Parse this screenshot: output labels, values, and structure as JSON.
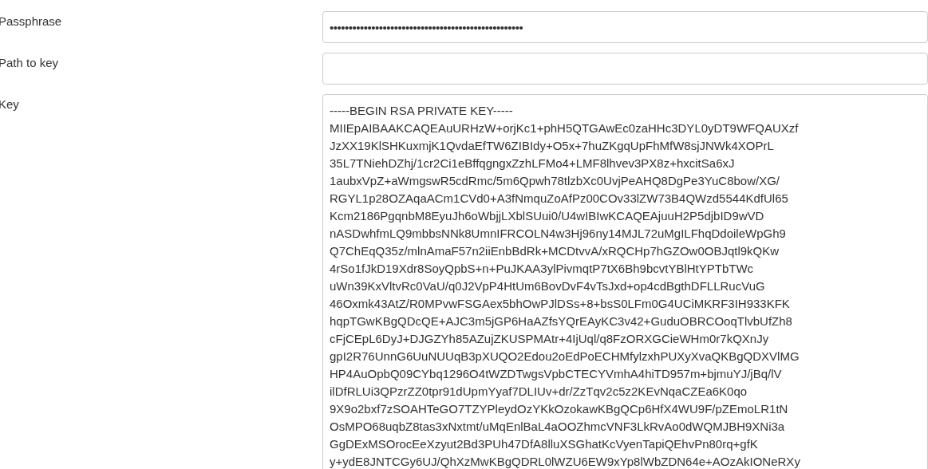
{
  "fields": [
    {
      "kind": "input",
      "label": "Passphrase",
      "value": "•••••••••••••••••••••••••••••••••••••••••••••••••••"
    },
    {
      "kind": "input",
      "label": "Path to key"
    },
    {
      "kind": "textarea",
      "label": "Key",
      "value": "-----BEGIN RSA PRIVATE KEY-----\nMIIEpAIBAAKCAQEAuURHzW+orjKc1+phH5QTGAwEc0zaHHc3DYL0yDT9WFQAUXzf\nJzXX19KlSHKuxmjK1QvdaEfTW6ZIBIdy+O5x+7huZKgqUpFhMfW8sjJNWk4XOPrL\n35L7TNiehDZhj/1cr2Ci1eBffqgngxZzhLFMo4+LMF8lhvev3PX8z+hxcitSa6xJ\n1aubxVpZ+aWmgswR5cdRmc/5m6Qpwh78tlzbXc0UvjPeAHQ8DgPe3YuC8bow/XG/\nRGYL1p28OZAqaACm1CVd0+A3fNmquZoAfPz00COv33lZW73B4QWzd5544KdfUl65\nKcm2186PgqnbM8EyuJh6oWbjjLXblSUui0/U4wIBIwKCAQEAjuuH2P5djbID9wVD\nnASDwhfmLQ9mbbsNNk8UmnIFRCOLN4w3Hj96ny14MJL72uMgILFhqDdoileWpGh9\nQ7ChEqQ35z/mlnAmaF57n2iiEnbBdRk+MCDtvvA/xRQCHp7hGZOw0OBJqtl9kQKw\n4rSo1fJkD19Xdr8SoyQpbS+n+PuJKAA3ylPivmqtP7tX6Bh9bcvtYBlHtYPTbTWc\nuWn39KxVltvRc0VaU/q0J2VpP4HtUm6BovDvF4vTsJxd+op4cdBgthDFLLRucVuG\n46Oxmk43AtZ/R0MPvwFSGAex5bhOwPJlDSs+8+bsS0LFm0G4UCiMKRF3IH933KFK\nhqpTGwKBgQDcQE+AJC3m5jGP6HaAZfsYQrEAyKC3v42+GuduOBRCOoqTlvbUfZh8\ncFjCEpL6DyJ+DJGZYh85AZujZKUSPMAtr+4IjUql/q8FzORXGCieWHm0r7kQXnJy\ngpI2R76UnnG6UuNUUqB3pXUQO2Edou2oEdPoECHMfylzxhPUXyXvaQKBgQDXVlMG\nHP4AuOpbQ09CYbq1296O4tWZDTwgsVpbCTECYVmhA4hiTD957m+bjmuYJ/jBq/lV\nilDfRLUi3QPzrZZ0tpr91dUpmYyaf7DLIUv+dr/ZzTqv2c5z2KEvNqaCZEa6K0qo\n9X9o2bxf7zSOAHTeGO7TZYPleydOzYKkOzokawKBgQCp6HfX4WU9F/pZEmoLR1tN\nOsMPO68uqbZ8tas3xNxtmt/uMqEnlBaL4aOOZhmcVNF3LkRvAo0dWQMJBH9XNi3a\nGgDExMSOrocEeXzyut2Bd3PUh47DfA8lluXSGhatKcVyenTapiQEhvPn80rq+gfK\ny+ydE8JNTCGy6UJ/QhXzMwKBgQDRL0lWZU6EW9xYp8lWbZDN64e+AOzAkIONeRXy"
    }
  ]
}
